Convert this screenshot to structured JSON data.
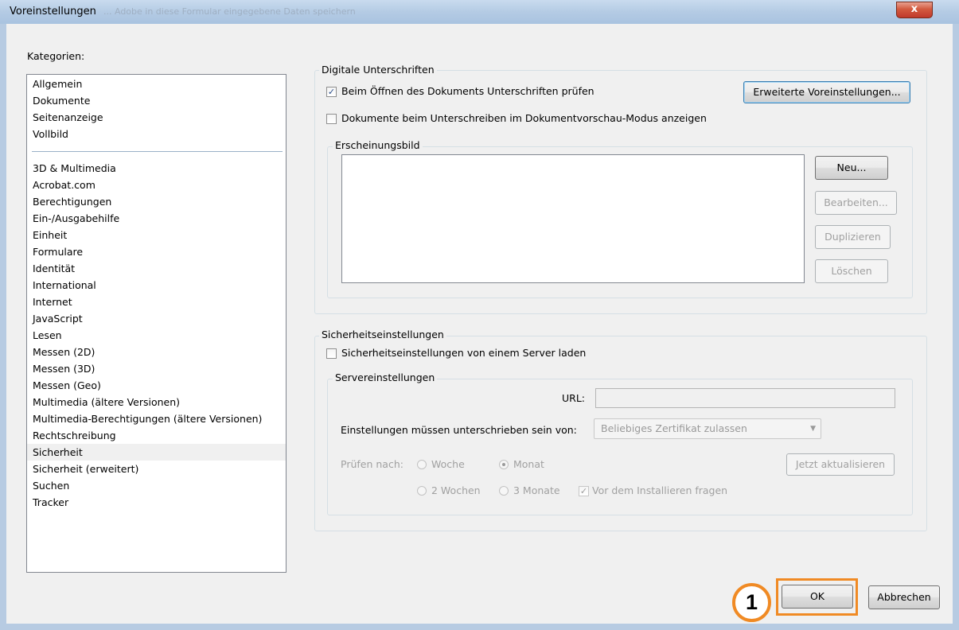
{
  "window": {
    "title": "Voreinstellungen",
    "ghost_title": "... Adobe in diese Formular eingegebene Daten speichern",
    "close_label": "x"
  },
  "categories": {
    "label": "Kategorien:",
    "group1": [
      "Allgemein",
      "Dokumente",
      "Seitenanzeige",
      "Vollbild"
    ],
    "group2": [
      "3D & Multimedia",
      "Acrobat.com",
      "Berechtigungen",
      "Ein-/Ausgabehilfe",
      "Einheit",
      "Formulare",
      "Identität",
      "International",
      "Internet",
      "JavaScript",
      "Lesen",
      "Messen (2D)",
      "Messen (3D)",
      "Messen (Geo)",
      "Multimedia (ältere Versionen)",
      "Multimedia-Berechtigungen (ältere Versionen)",
      "Rechtschreibung",
      "Sicherheit",
      "Sicherheit (erweitert)",
      "Suchen",
      "Tracker"
    ],
    "selected": "Sicherheit"
  },
  "digital_signatures": {
    "title": "Digitale Unterschriften",
    "verify_on_open": {
      "label": "Beim Öffnen des Dokuments Unterschriften prüfen",
      "checked": true
    },
    "preview_mode": {
      "label": "Dokumente beim Unterschreiben im Dokumentvorschau-Modus anzeigen",
      "checked": false
    },
    "advanced_button": "Erweiterte Voreinstellungen...",
    "appearance": {
      "title": "Erscheinungsbild",
      "new_button": "Neu...",
      "edit_button": "Bearbeiten...",
      "duplicate_button": "Duplizieren",
      "delete_button": "Löschen"
    }
  },
  "security_settings": {
    "title": "Sicherheitseinstellungen",
    "load_from_server": {
      "label": "Sicherheitseinstellungen von einem Server laden",
      "checked": false
    },
    "server": {
      "title": "Servereinstellungen",
      "url_label": "URL:",
      "url_value": "",
      "signed_label": "Einstellungen müssen unterschrieben sein von:",
      "signed_value": "Beliebiges Zertifikat zulassen",
      "check_label": "Prüfen nach:",
      "radio_week": "Woche",
      "radio_month": "Monat",
      "radio_two_weeks": "2 Wochen",
      "radio_three_months": "3 Monate",
      "selected_interval": "Monat",
      "ask_before_install": {
        "label": "Vor dem Installieren fragen",
        "checked": true
      },
      "update_now_button": "Jetzt aktualisieren"
    }
  },
  "footer": {
    "ok_button": "OK",
    "cancel_button": "Abbrechen",
    "step_marker": "1",
    "highlight_color": "#f08a24"
  }
}
